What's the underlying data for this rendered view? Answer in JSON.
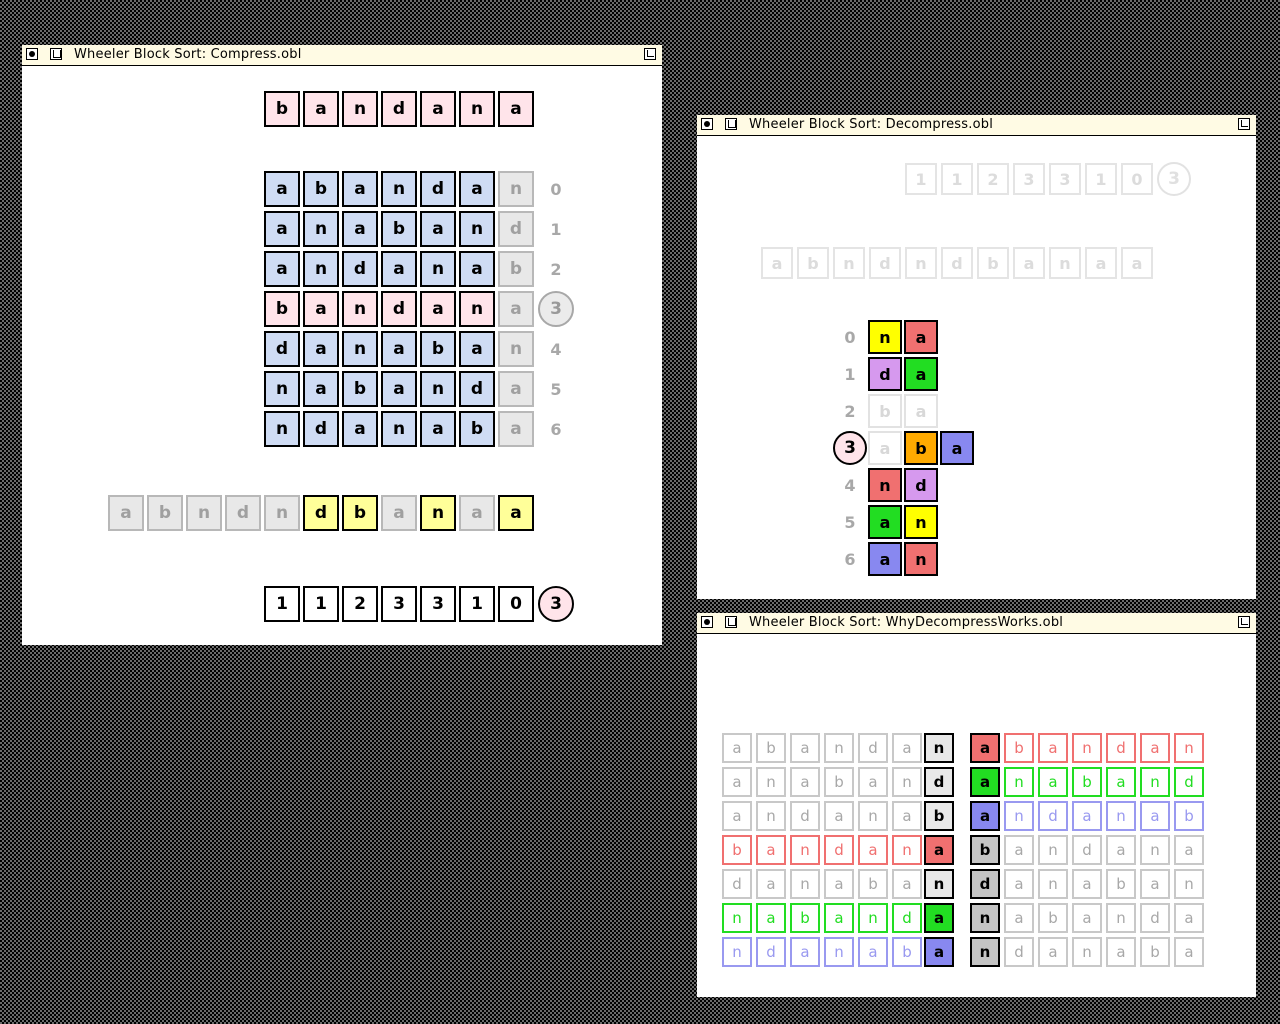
{
  "colors": {
    "pink": "#ffe4ea",
    "blue": "#cfdcf4",
    "ghost": "#e8e8e8",
    "yellow": "#ffff99",
    "red": "#f07070",
    "green": "#22dd22",
    "violet": "#8888f0",
    "purple": "#d699ee",
    "orange": "#ffaa00",
    "light_gray": "#d0d0d0",
    "red_outline": "#f07070",
    "green_outline": "#22dd22",
    "violet_outline": "#9999f0"
  },
  "compress": {
    "title": "Wheeler Block Sort: Compress.obl",
    "input": [
      "b",
      "a",
      "n",
      "d",
      "a",
      "n",
      "a"
    ],
    "rotations": [
      [
        "a",
        "b",
        "a",
        "n",
        "d",
        "a",
        "n"
      ],
      [
        "a",
        "n",
        "a",
        "b",
        "a",
        "n",
        "d"
      ],
      [
        "a",
        "n",
        "d",
        "a",
        "n",
        "a",
        "b"
      ],
      [
        "b",
        "a",
        "n",
        "d",
        "a",
        "n",
        "a"
      ],
      [
        "d",
        "a",
        "n",
        "a",
        "b",
        "a",
        "n"
      ],
      [
        "n",
        "a",
        "b",
        "a",
        "n",
        "d",
        "a"
      ],
      [
        "n",
        "d",
        "a",
        "n",
        "a",
        "b",
        "a"
      ]
    ],
    "row_indices": [
      "0",
      "1",
      "2",
      "3",
      "4",
      "5",
      "6"
    ],
    "original_row_marker": "3",
    "output_string": [
      {
        "ch": "a",
        "style": "ghost"
      },
      {
        "ch": "b",
        "style": "ghost"
      },
      {
        "ch": "n",
        "style": "ghost"
      },
      {
        "ch": "d",
        "style": "ghost"
      },
      {
        "ch": "n",
        "style": "ghost"
      },
      {
        "ch": "d",
        "style": "yellow"
      },
      {
        "ch": "b",
        "style": "yellow"
      },
      {
        "ch": "a",
        "style": "ghost"
      },
      {
        "ch": "n",
        "style": "yellow"
      },
      {
        "ch": "a",
        "style": "ghost"
      },
      {
        "ch": "a",
        "style": "yellow"
      }
    ],
    "mtf_codes": [
      "1",
      "1",
      "2",
      "3",
      "3",
      "1",
      "0"
    ],
    "mtf_marker": "3"
  },
  "decompress": {
    "title": "Wheeler Block Sort: Decompress.obl",
    "codes": [
      "1",
      "1",
      "2",
      "3",
      "3",
      "1",
      "0"
    ],
    "codes_marker": "3",
    "string": [
      "a",
      "b",
      "n",
      "d",
      "n",
      "d",
      "b",
      "a",
      "n",
      "a",
      "a"
    ],
    "row_indices": [
      "0",
      "1",
      "2",
      "3",
      "4",
      "5",
      "6"
    ],
    "marker": "3",
    "rows": [
      [
        {
          "ch": "n",
          "bg": "#ffff00"
        },
        {
          "ch": "a",
          "bg": "#f07070"
        }
      ],
      [
        {
          "ch": "d",
          "bg": "#d699ee"
        },
        {
          "ch": "a",
          "bg": "#22dd22"
        }
      ],
      [
        {
          "ch": "b",
          "bg": "faint"
        },
        {
          "ch": "a",
          "bg": "faint"
        }
      ],
      [
        {
          "ch": "a",
          "bg": "faint"
        },
        {
          "ch": "b",
          "bg": "#ffaa00"
        },
        {
          "ch": "a",
          "bg": "#8888f0"
        }
      ],
      [
        {
          "ch": "n",
          "bg": "#f07070"
        },
        {
          "ch": "d",
          "bg": "#d699ee"
        }
      ],
      [
        {
          "ch": "a",
          "bg": "#22dd22"
        },
        {
          "ch": "n",
          "bg": "#ffff00"
        }
      ],
      [
        {
          "ch": "a",
          "bg": "#8888f0"
        },
        {
          "ch": "n",
          "bg": "#f07070"
        }
      ]
    ]
  },
  "why": {
    "title": "Wheeler Block Sort: WhyDecompressWorks.obl",
    "left_rows": [
      {
        "cells": [
          "a",
          "b",
          "a",
          "n",
          "d",
          "a"
        ],
        "last": "n",
        "outline": "",
        "last_bg": "#e8e8e8"
      },
      {
        "cells": [
          "a",
          "n",
          "a",
          "b",
          "a",
          "n"
        ],
        "last": "d",
        "outline": "",
        "last_bg": "#e8e8e8"
      },
      {
        "cells": [
          "a",
          "n",
          "d",
          "a",
          "n",
          "a"
        ],
        "last": "b",
        "outline": "",
        "last_bg": "#e8e8e8"
      },
      {
        "cells": [
          "b",
          "a",
          "n",
          "d",
          "a",
          "n"
        ],
        "last": "a",
        "outline": "#f07070",
        "last_bg": "#f07070"
      },
      {
        "cells": [
          "d",
          "a",
          "n",
          "a",
          "b",
          "a"
        ],
        "last": "n",
        "outline": "",
        "last_bg": "#e8e8e8"
      },
      {
        "cells": [
          "n",
          "a",
          "b",
          "a",
          "n",
          "d"
        ],
        "last": "a",
        "outline": "#22dd22",
        "last_bg": "#22dd22"
      },
      {
        "cells": [
          "n",
          "d",
          "a",
          "n",
          "a",
          "b"
        ],
        "last": "a",
        "outline": "#9999f0",
        "last_bg": "#8888f0"
      }
    ],
    "right_rows": [
      {
        "first": "a",
        "first_bg": "#f07070",
        "cells": [
          "b",
          "a",
          "n",
          "d",
          "a",
          "n"
        ],
        "outline": "#f07070"
      },
      {
        "first": "a",
        "first_bg": "#22dd22",
        "cells": [
          "n",
          "a",
          "b",
          "a",
          "n",
          "d"
        ],
        "outline": "#22dd22"
      },
      {
        "first": "a",
        "first_bg": "#8888f0",
        "cells": [
          "n",
          "d",
          "a",
          "n",
          "a",
          "b"
        ],
        "outline": "#9999f0"
      },
      {
        "first": "b",
        "first_bg": "#c4c4c4",
        "cells": [
          "a",
          "n",
          "d",
          "a",
          "n",
          "a"
        ],
        "outline": ""
      },
      {
        "first": "d",
        "first_bg": "#c4c4c4",
        "cells": [
          "a",
          "n",
          "a",
          "b",
          "a",
          "n"
        ],
        "outline": ""
      },
      {
        "first": "n",
        "first_bg": "#c4c4c4",
        "cells": [
          "a",
          "b",
          "a",
          "n",
          "d",
          "a"
        ],
        "outline": ""
      },
      {
        "first": "n",
        "first_bg": "#c4c4c4",
        "cells": [
          "d",
          "a",
          "n",
          "a",
          "b",
          "a"
        ],
        "outline": ""
      }
    ]
  }
}
